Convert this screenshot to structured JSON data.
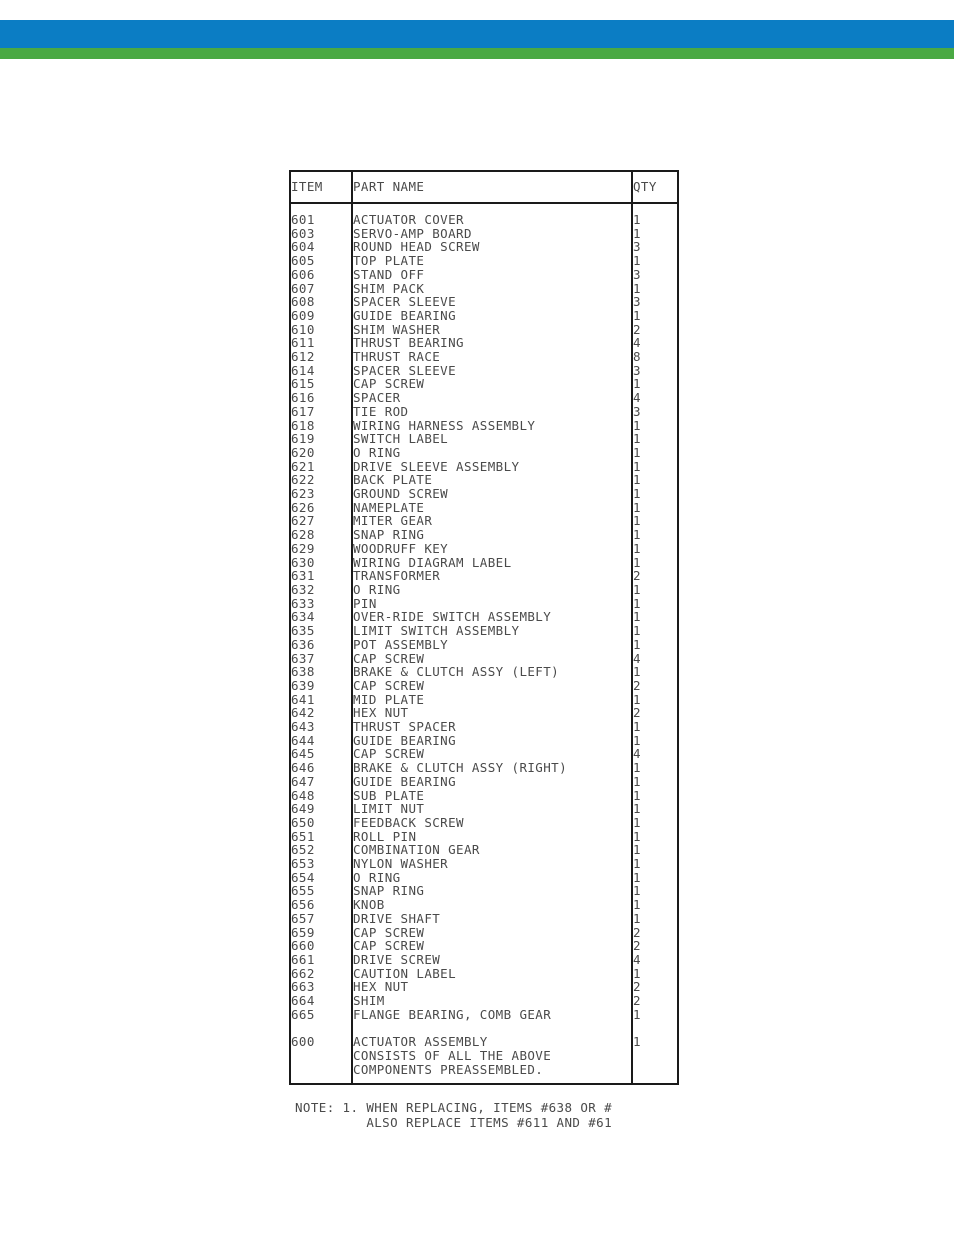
{
  "header": {
    "blue_bar_color": "#0b7dc4",
    "green_bar_color": "#4aa943"
  },
  "table": {
    "columns": {
      "item": "ITEM",
      "part_name": "PART NAME",
      "qty": "QTY"
    },
    "rows": [
      {
        "item": "601",
        "name": "ACTUATOR COVER",
        "qty": "1"
      },
      {
        "item": "603",
        "name": "SERVO-AMP BOARD",
        "qty": "1"
      },
      {
        "item": "604",
        "name": "ROUND HEAD SCREW",
        "qty": "3"
      },
      {
        "item": "605",
        "name": "TOP PLATE",
        "qty": "1"
      },
      {
        "item": "606",
        "name": "STAND OFF",
        "qty": "3"
      },
      {
        "item": "607",
        "name": "SHIM PACK",
        "qty": "1"
      },
      {
        "item": "608",
        "name": "SPACER SLEEVE",
        "qty": "3"
      },
      {
        "item": "609",
        "name": "GUIDE BEARING",
        "qty": "1"
      },
      {
        "item": "610",
        "name": "SHIM WASHER",
        "qty": "2"
      },
      {
        "item": "611",
        "name": "THRUST BEARING",
        "qty": "4"
      },
      {
        "item": "612",
        "name": "THRUST RACE",
        "qty": "8"
      },
      {
        "item": "614",
        "name": "SPACER SLEEVE",
        "qty": "3"
      },
      {
        "item": "615",
        "name": "CAP SCREW",
        "qty": "1"
      },
      {
        "item": "616",
        "name": "SPACER",
        "qty": "4"
      },
      {
        "item": "617",
        "name": "TIE ROD",
        "qty": "3"
      },
      {
        "item": "618",
        "name": "WIRING HARNESS ASSEMBLY",
        "qty": "1"
      },
      {
        "item": "619",
        "name": "SWITCH LABEL",
        "qty": "1"
      },
      {
        "item": "620",
        "name": "O RING",
        "qty": "1"
      },
      {
        "item": "621",
        "name": "DRIVE SLEEVE ASSEMBLY",
        "qty": "1"
      },
      {
        "item": "622",
        "name": "BACK PLATE",
        "qty": "1"
      },
      {
        "item": "623",
        "name": "GROUND SCREW",
        "qty": "1"
      },
      {
        "item": "626",
        "name": "NAMEPLATE",
        "qty": "1"
      },
      {
        "item": "627",
        "name": "MITER GEAR",
        "qty": "1"
      },
      {
        "item": "628",
        "name": "SNAP RING",
        "qty": "1"
      },
      {
        "item": "629",
        "name": "WOODRUFF KEY",
        "qty": "1"
      },
      {
        "item": "630",
        "name": "WIRING DIAGRAM LABEL",
        "qty": "1"
      },
      {
        "item": "631",
        "name": "TRANSFORMER",
        "qty": "2"
      },
      {
        "item": "632",
        "name": "O RING",
        "qty": "1"
      },
      {
        "item": "633",
        "name": "PIN",
        "qty": "1"
      },
      {
        "item": "634",
        "name": "OVER-RIDE SWITCH ASSEMBLY",
        "qty": "1"
      },
      {
        "item": "635",
        "name": "LIMIT SWITCH ASSEMBLY",
        "qty": "1"
      },
      {
        "item": "636",
        "name": "POT ASSEMBLY",
        "qty": "1"
      },
      {
        "item": "637",
        "name": "CAP SCREW",
        "qty": "4"
      },
      {
        "item": "638",
        "name": "BRAKE & CLUTCH ASSY (LEFT)",
        "qty": "1"
      },
      {
        "item": "639",
        "name": "CAP SCREW",
        "qty": "2"
      },
      {
        "item": "641",
        "name": "MID PLATE",
        "qty": "1"
      },
      {
        "item": "642",
        "name": "HEX NUT",
        "qty": "2"
      },
      {
        "item": "643",
        "name": "THRUST SPACER",
        "qty": "1"
      },
      {
        "item": "644",
        "name": "GUIDE BEARING",
        "qty": "1"
      },
      {
        "item": "645",
        "name": "CAP SCREW",
        "qty": "4"
      },
      {
        "item": "646",
        "name": "BRAKE & CLUTCH ASSY (RIGHT)",
        "qty": "1"
      },
      {
        "item": "647",
        "name": "GUIDE BEARING",
        "qty": "1"
      },
      {
        "item": "648",
        "name": "SUB PLATE",
        "qty": "1"
      },
      {
        "item": "649",
        "name": "LIMIT NUT",
        "qty": "1"
      },
      {
        "item": "650",
        "name": "FEEDBACK SCREW",
        "qty": "1"
      },
      {
        "item": "651",
        "name": "ROLL PIN",
        "qty": "1"
      },
      {
        "item": "652",
        "name": "COMBINATION GEAR",
        "qty": "1"
      },
      {
        "item": "653",
        "name": "NYLON WASHER",
        "qty": "1"
      },
      {
        "item": "654",
        "name": "O RING",
        "qty": "1"
      },
      {
        "item": "655",
        "name": "SNAP RING",
        "qty": "1"
      },
      {
        "item": "656",
        "name": "KNOB",
        "qty": "1"
      },
      {
        "item": "657",
        "name": "DRIVE SHAFT",
        "qty": "1"
      },
      {
        "item": "659",
        "name": "CAP SCREW",
        "qty": "2"
      },
      {
        "item": "660",
        "name": "CAP SCREW",
        "qty": "2"
      },
      {
        "item": "661",
        "name": "DRIVE SCREW",
        "qty": "4"
      },
      {
        "item": "662",
        "name": "CAUTION LABEL",
        "qty": "1"
      },
      {
        "item": "663",
        "name": "HEX NUT",
        "qty": "2"
      },
      {
        "item": "664",
        "name": "SHIM",
        "qty": "2"
      },
      {
        "item": "665",
        "name": "FLANGE BEARING, COMB GEAR",
        "qty": "1"
      }
    ],
    "assembly": {
      "item": "600",
      "name": "ACTUATOR ASSEMBLY\nCONSISTS OF ALL THE ABOVE\nCOMPONENTS PREASSEMBLED.",
      "qty": "1"
    }
  },
  "note": {
    "text": "NOTE: 1. WHEN REPLACING, ITEMS #638 OR #\n         ALSO REPLACE ITEMS #611 AND #61"
  }
}
